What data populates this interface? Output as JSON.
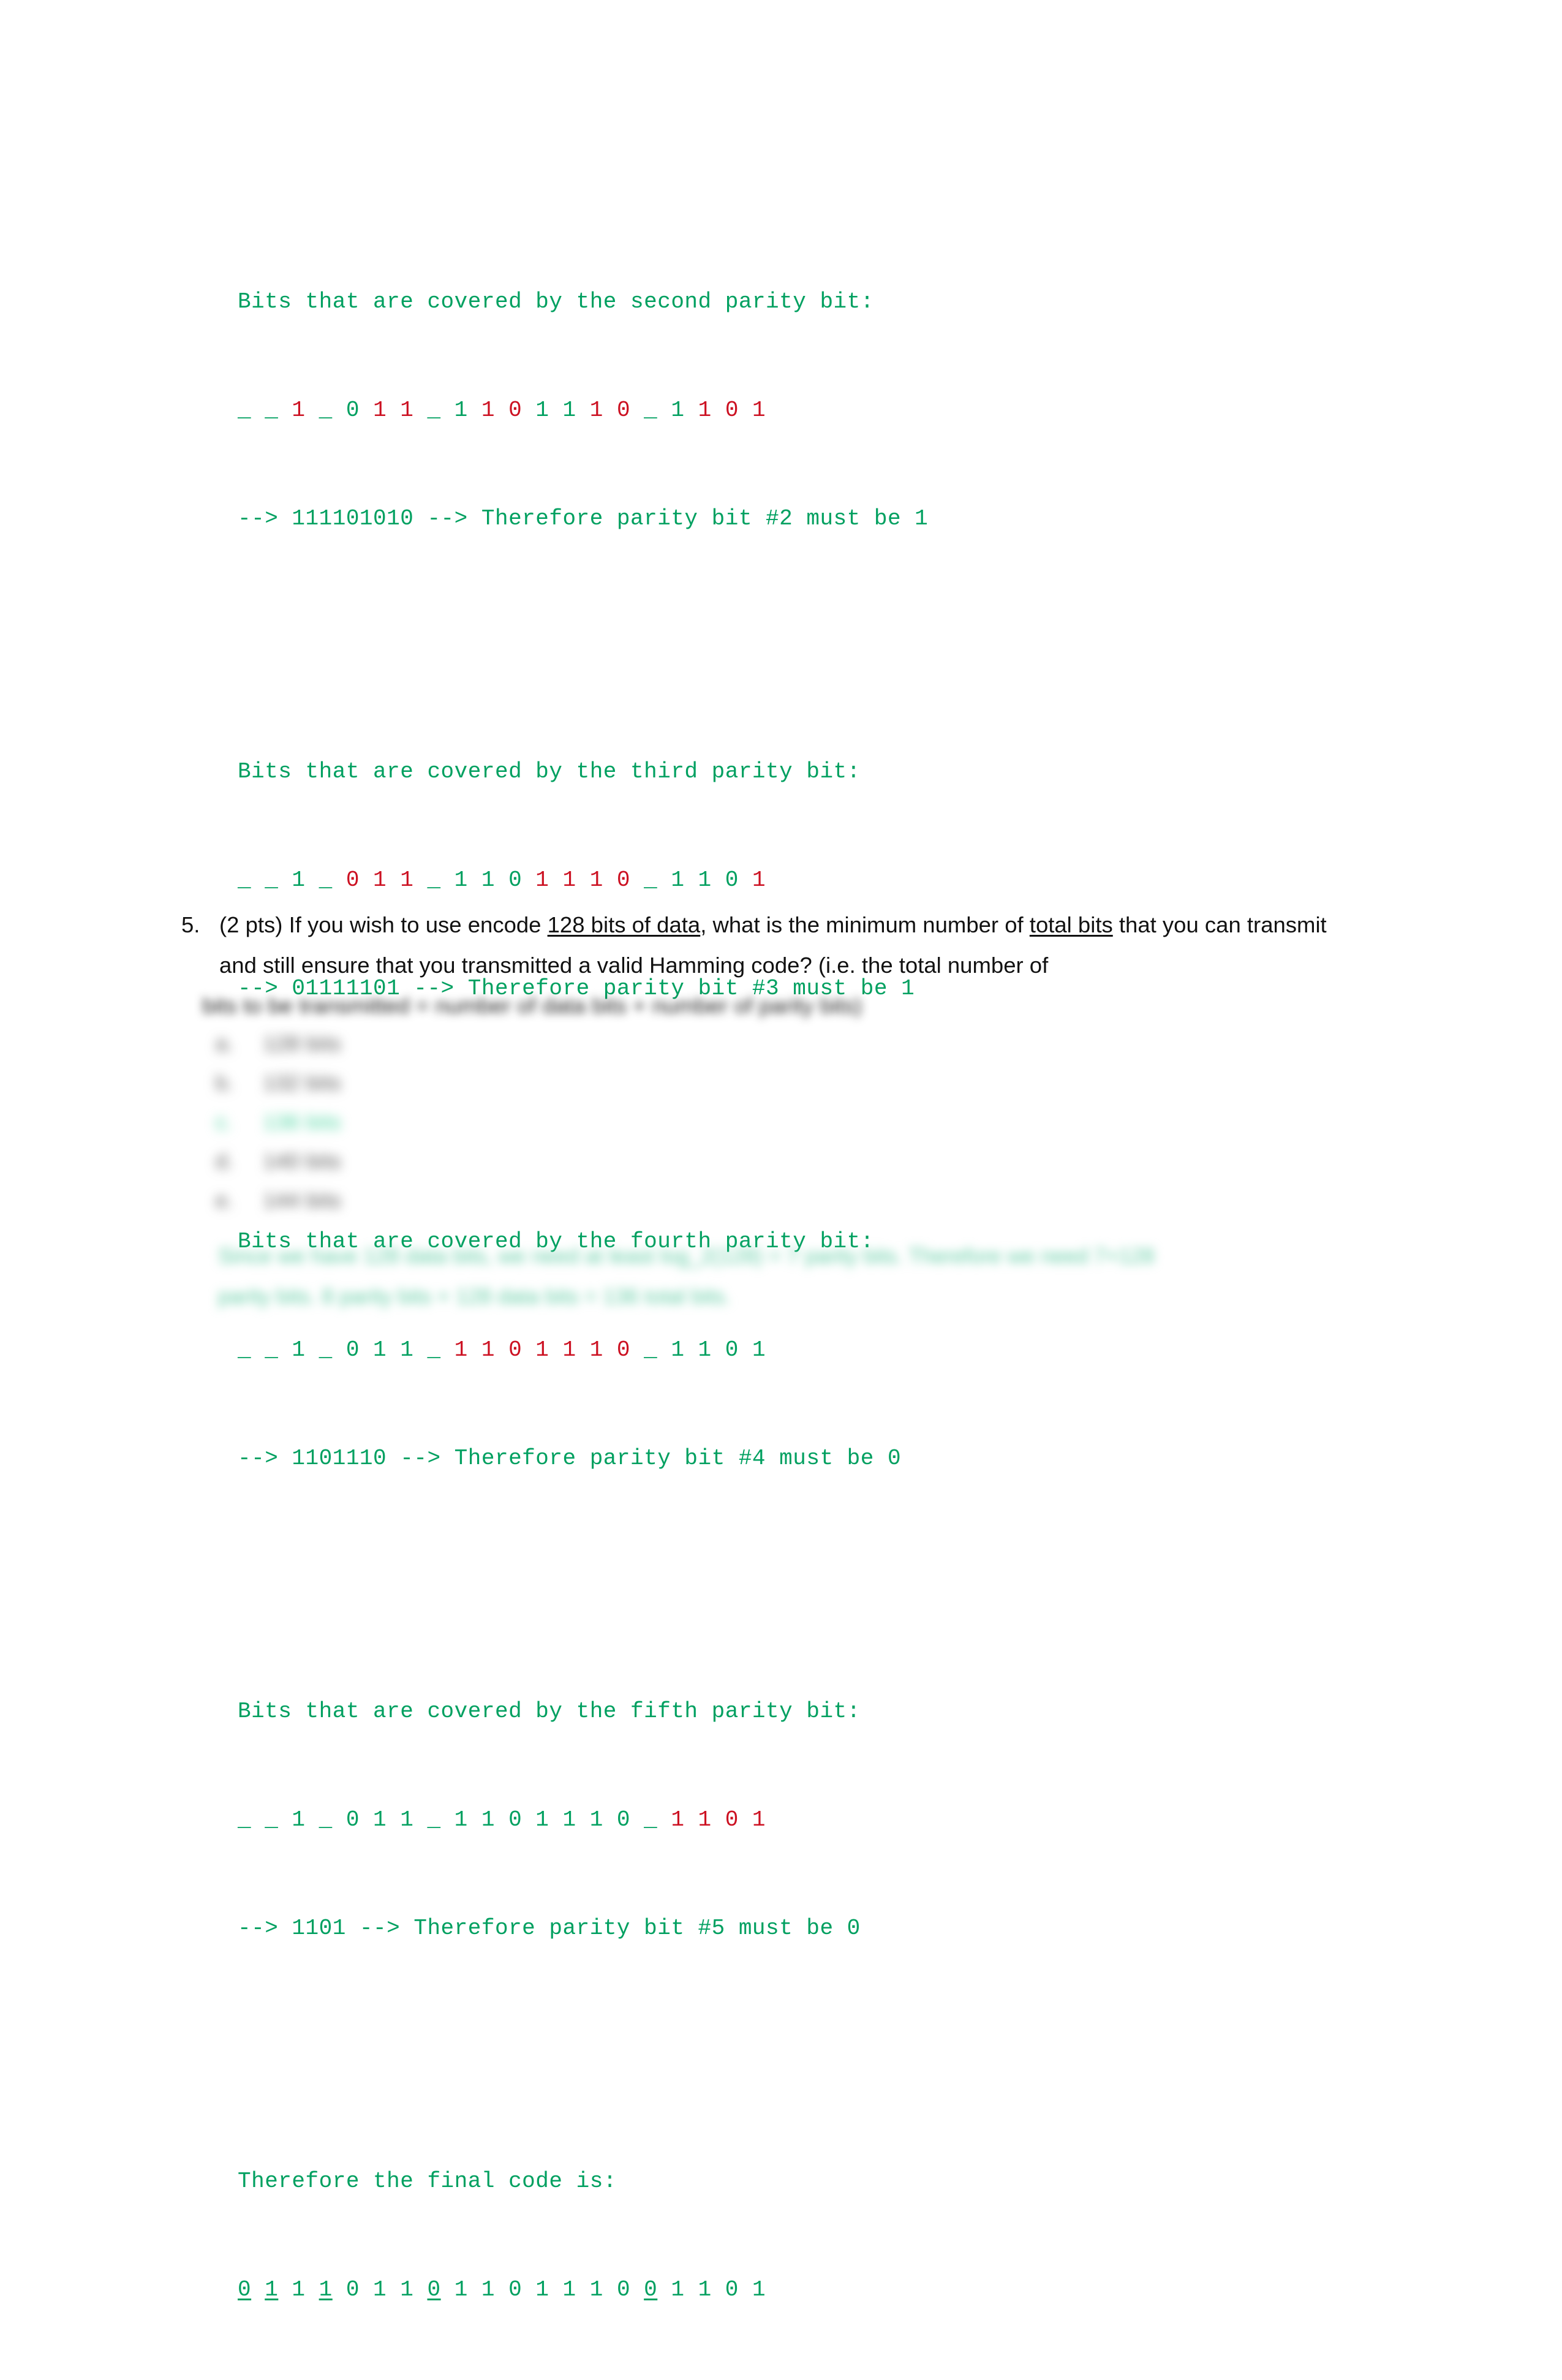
{
  "document": {
    "type": "homework-solution-page",
    "colors": {
      "code_green": "#00a060",
      "code_red": "#cc1122",
      "body_text": "#111111",
      "highlight_green": "#3fd39a",
      "page_background": "#ffffff"
    }
  },
  "code_block": {
    "lines": [
      {
        "id": "p2-header",
        "text": "Bits that are covered by the second parity bit:"
      },
      {
        "id": "p2-bits",
        "segments": [
          {
            "text": "_ _ ",
            "color": "green"
          },
          {
            "text": "1",
            "color": "red"
          },
          {
            "text": " _ ",
            "color": "green"
          },
          {
            "text": "0",
            "color": "green"
          },
          {
            "text": " ",
            "color": "green"
          },
          {
            "text": "1 1",
            "color": "red"
          },
          {
            "text": " _ ",
            "color": "green"
          },
          {
            "text": "1",
            "color": "green"
          },
          {
            "text": " ",
            "color": "green"
          },
          {
            "text": "1",
            "color": "red"
          },
          {
            "text": " ",
            "color": "green"
          },
          {
            "text": "0",
            "color": "red"
          },
          {
            "text": " ",
            "color": "green"
          },
          {
            "text": "1",
            "color": "green"
          },
          {
            "text": " ",
            "color": "green"
          },
          {
            "text": "1",
            "color": "green"
          },
          {
            "text": " ",
            "color": "green"
          },
          {
            "text": "1 0",
            "color": "red"
          },
          {
            "text": " _ ",
            "color": "green"
          },
          {
            "text": "1",
            "color": "green"
          },
          {
            "text": " ",
            "color": "green"
          },
          {
            "text": "1",
            "color": "red"
          },
          {
            "text": " ",
            "color": "green"
          },
          {
            "text": "0",
            "color": "red"
          },
          {
            "text": " ",
            "color": "green"
          },
          {
            "text": "1",
            "color": "red"
          }
        ]
      },
      {
        "id": "p2-result",
        "text": "--> 111101010 --> Therefore parity bit #2 must be 1"
      },
      {
        "id": "gap-1",
        "text": ""
      },
      {
        "id": "p3-header",
        "text": "Bits that are covered by the third parity bit:"
      },
      {
        "id": "p3-bits",
        "segments": [
          {
            "text": "_ _ ",
            "color": "green"
          },
          {
            "text": "1",
            "color": "green"
          },
          {
            "text": " _ ",
            "color": "green"
          },
          {
            "text": "0 1 1",
            "color": "red"
          },
          {
            "text": " _ ",
            "color": "green"
          },
          {
            "text": "1",
            "color": "green"
          },
          {
            "text": " ",
            "color": "green"
          },
          {
            "text": "1",
            "color": "green"
          },
          {
            "text": " ",
            "color": "green"
          },
          {
            "text": "0",
            "color": "green"
          },
          {
            "text": " ",
            "color": "green"
          },
          {
            "text": "1 1 1 0",
            "color": "red"
          },
          {
            "text": " _ ",
            "color": "green"
          },
          {
            "text": "1 1 0",
            "color": "green"
          },
          {
            "text": " ",
            "color": "green"
          },
          {
            "text": "1",
            "color": "red"
          }
        ]
      },
      {
        "id": "p3-result",
        "text": "--> 01111101 --> Therefore parity bit #3 must be 1"
      },
      {
        "id": "gap-2",
        "text": ""
      },
      {
        "id": "p4-header",
        "text": "Bits that are covered by the fourth parity bit:"
      },
      {
        "id": "p4-bits",
        "segments": [
          {
            "text": "_ _ 1 _ 0 1 1 _ ",
            "color": "green"
          },
          {
            "text": "1 1 0 1 1 1 0",
            "color": "red"
          },
          {
            "text": " _ 1 1 0 1",
            "color": "green"
          }
        ]
      },
      {
        "id": "p4-result",
        "text": "--> 1101110 --> Therefore parity bit #4 must be 0"
      },
      {
        "id": "gap-3",
        "text": ""
      },
      {
        "id": "p5-header",
        "text": "Bits that are covered by the fifth parity bit:"
      },
      {
        "id": "p5-bits",
        "segments": [
          {
            "text": "_ _ 1 _ 0 1 1 _ 1 1 0 1 1 1 0 _ ",
            "color": "green"
          },
          {
            "text": "1 1 0 1",
            "color": "red"
          }
        ]
      },
      {
        "id": "p5-result",
        "text": "--> 1101 --> Therefore parity bit #5 must be 0"
      },
      {
        "id": "gap-4",
        "text": ""
      },
      {
        "id": "final-header",
        "text": "Therefore the final code is:"
      },
      {
        "id": "final-bits",
        "segments": [
          {
            "text": "0",
            "color": "green",
            "underline": true
          },
          {
            "text": " ",
            "color": "green"
          },
          {
            "text": "1",
            "color": "green",
            "underline": true
          },
          {
            "text": " 1 ",
            "color": "green"
          },
          {
            "text": "1",
            "color": "green",
            "underline": true
          },
          {
            "text": " 0 1 1 ",
            "color": "green"
          },
          {
            "text": "0",
            "color": "green",
            "underline": true
          },
          {
            "text": " 1 1 0 1 1 1 0 ",
            "color": "green"
          },
          {
            "text": "0",
            "color": "green",
            "underline": true
          },
          {
            "text": " 1 1 0 1",
            "color": "green"
          }
        ]
      }
    ],
    "plain_text_summary": {
      "parity2_header": "Bits that are covered by the second parity bit:",
      "parity2_bits": "_ _ 1 _ 0 1 1 _ 1 1 0 1 1 1 0 _ 1 1 0 1",
      "parity2_result": "--> 111101010 --> Therefore parity bit #2 must be 1",
      "parity3_header": "Bits that are covered by the third parity bit:",
      "parity3_bits": "_ _ 1 _ 0 1 1 _ 1 1 0 1 1 1 0 _ 1 1 0 1",
      "parity3_result": "--> 01111101 --> Therefore parity bit #3 must be 1",
      "parity4_header": "Bits that are covered by the fourth parity bit:",
      "parity4_bits": "_ _ 1 _ 0 1 1 _ 1 1 0 1 1 1 0 _ 1 1 0 1",
      "parity4_result": "--> 1101110 --> Therefore parity bit #4 must be 0",
      "parity5_header": "Bits that are covered by the fifth parity bit:",
      "parity5_bits": "_ _ 1 _ 0 1 1 _ 1 1 0 1 1 1 0 _ 1 1 0 1",
      "parity5_result": "--> 1101 --> Therefore parity bit #5 must be 0",
      "final_header": "Therefore the final code is:",
      "final_bits": "0 1 1 1 0 1 1 0 1 1 0 1 1 1 0 0 1 1 0 1"
    }
  },
  "question5": {
    "number": "5.",
    "line1_a": "(2 pts) If you wish to use encode ",
    "line1_underline1": "128 bits of data",
    "line1_b": ", what is the minimum number of ",
    "line1_underline2": "total bits",
    "line1_c": " that you",
    "line2": "can transmit and still ensure that you transmitted a valid Hamming code? (i.e. the total number of",
    "line3": "bits to be transmitted = number of data bits + number of parity bits)",
    "options": [
      {
        "letter": "a.",
        "text": "128 bits",
        "correct": false
      },
      {
        "letter": "b.",
        "text": "132 bits",
        "correct": false
      },
      {
        "letter": "c.",
        "text": "136 bits",
        "correct": true
      },
      {
        "letter": "d.",
        "text": "140 bits",
        "correct": false
      },
      {
        "letter": "e.",
        "text": "144 bits",
        "correct": false
      }
    ],
    "explanation": [
      "Since we have 128 data bits, we need at least log_2(128) = 7 parity bits. Therefore we need 7+128",
      "parity bits. 8 parity bits + 128 data bits = 136 total bits."
    ]
  }
}
